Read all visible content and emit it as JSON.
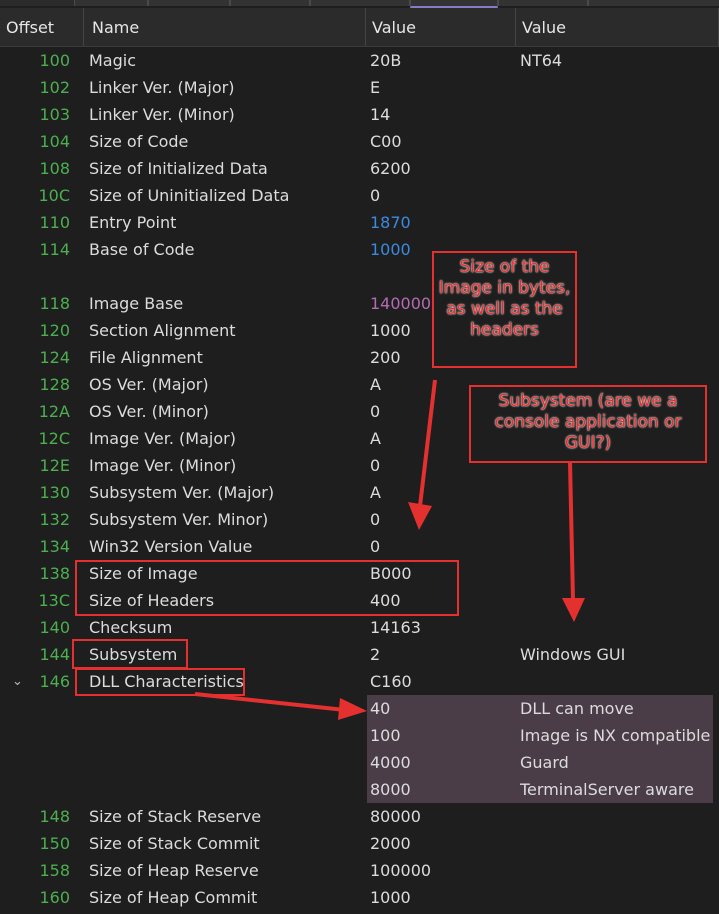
{
  "headers": {
    "offset": "Offset",
    "name": "Name",
    "value1": "Value",
    "value2": "Value"
  },
  "rows": [
    {
      "offset": "100",
      "name": "Magic",
      "value": "20B",
      "extra": "NT64"
    },
    {
      "offset": "102",
      "name": "Linker Ver. (Major)",
      "value": "E"
    },
    {
      "offset": "103",
      "name": "Linker Ver. (Minor)",
      "value": "14"
    },
    {
      "offset": "104",
      "name": "Size of Code",
      "value": "C00"
    },
    {
      "offset": "108",
      "name": "Size of Initialized Data",
      "value": "6200"
    },
    {
      "offset": "10C",
      "name": "Size of Uninitialized Data",
      "value": "0"
    },
    {
      "offset": "110",
      "name": "Entry Point",
      "value": "1870",
      "style": "link"
    },
    {
      "offset": "114",
      "name": "Base of Code",
      "value": "1000",
      "style": "link"
    },
    {
      "offset": "",
      "name": "",
      "value": ""
    },
    {
      "offset": "118",
      "name": "Image Base",
      "value": "140000000",
      "style": "purple"
    },
    {
      "offset": "120",
      "name": "Section Alignment",
      "value": "1000"
    },
    {
      "offset": "124",
      "name": "File Alignment",
      "value": "200"
    },
    {
      "offset": "128",
      "name": "OS Ver. (Major)",
      "value": "A"
    },
    {
      "offset": "12A",
      "name": "OS Ver. (Minor)",
      "value": "0"
    },
    {
      "offset": "12C",
      "name": "Image Ver. (Major)",
      "value": "A"
    },
    {
      "offset": "12E",
      "name": "Image Ver. (Minor)",
      "value": "0"
    },
    {
      "offset": "130",
      "name": "Subsystem Ver. (Major)",
      "value": "A"
    },
    {
      "offset": "132",
      "name": "Subsystem Ver. Minor)",
      "value": "0"
    },
    {
      "offset": "134",
      "name": "Win32 Version Value",
      "value": "0"
    },
    {
      "offset": "138",
      "name": "Size of Image",
      "value": "B000"
    },
    {
      "offset": "13C",
      "name": "Size of Headers",
      "value": "400"
    },
    {
      "offset": "140",
      "name": "Checksum",
      "value": "14163"
    },
    {
      "offset": "144",
      "name": "Subsystem",
      "value": "2",
      "extra": "Windows GUI"
    },
    {
      "offset": "146",
      "name": "DLL Characteristics",
      "value": "C160",
      "expanded": true
    },
    {
      "sub": true,
      "value": "40",
      "extra": "DLL can move"
    },
    {
      "sub": true,
      "value": "100",
      "extra": "Image is NX compatible"
    },
    {
      "sub": true,
      "value": "4000",
      "extra": "Guard"
    },
    {
      "sub": true,
      "value": "8000",
      "extra": "TerminalServer aware"
    },
    {
      "offset": "148",
      "name": "Size of Stack Reserve",
      "value": "80000"
    },
    {
      "offset": "150",
      "name": "Size of Stack Commit",
      "value": "2000"
    },
    {
      "offset": "158",
      "name": "Size of Heap Reserve",
      "value": "100000"
    },
    {
      "offset": "160",
      "name": "Size of Heap Commit",
      "value": "1000"
    }
  ],
  "annotations": {
    "note1": "Size of the Image in bytes, as well as the headers",
    "note2": "Subsystem (are we a console application or GUI?)"
  },
  "colors": {
    "offset": "#4caf50",
    "link": "#3a8be0",
    "purple": "#b46bb4",
    "annotation": "#e53030",
    "flag_bg": "#4a3d48"
  }
}
